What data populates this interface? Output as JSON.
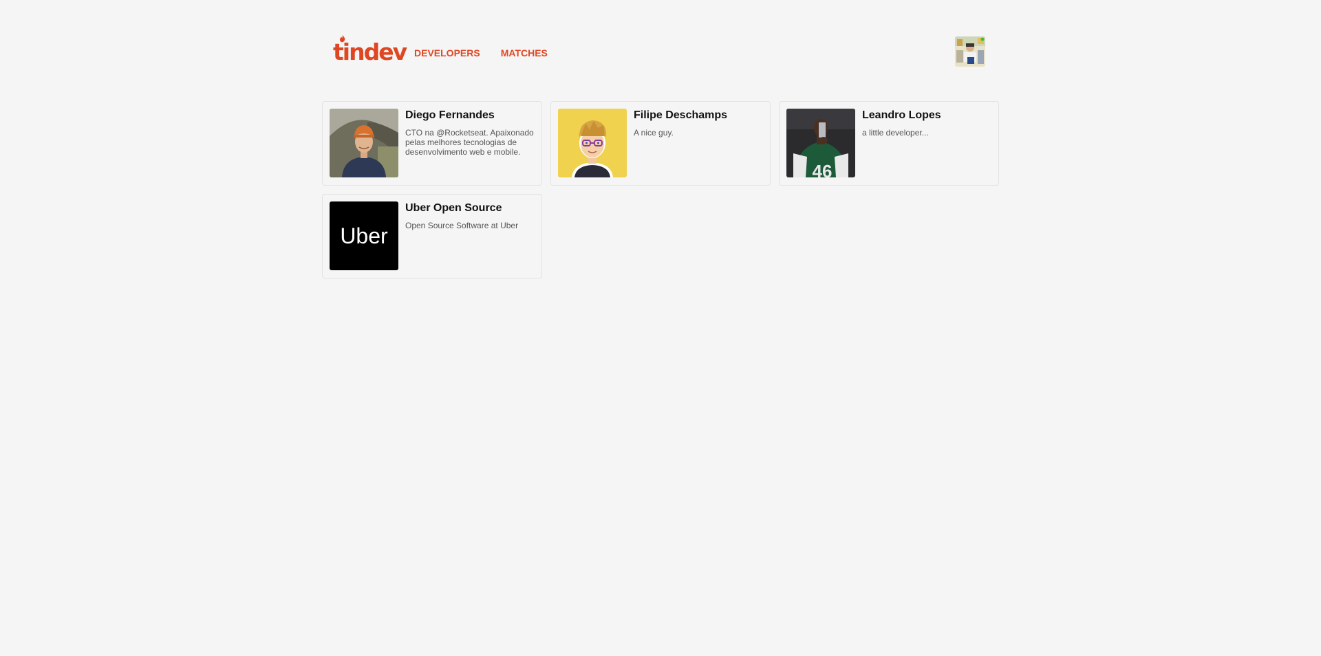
{
  "header": {
    "logo_text": "tindev",
    "brand_color": "#df4723",
    "nav": [
      {
        "label": "DEVELOPERS"
      },
      {
        "label": "MATCHES"
      }
    ]
  },
  "developers": [
    {
      "name": "Diego Fernandes",
      "bio": "CTO na @Rocketseat. Apaixonado pelas melhores tecnologias de desenvolvimento web e mobile."
    },
    {
      "name": "Filipe Deschamps",
      "bio": "A nice guy."
    },
    {
      "name": "Leandro Lopes",
      "bio": "a little developer..."
    },
    {
      "name": "Uber Open Source",
      "bio": "Open Source Software at Uber",
      "photo_text": "Uber"
    }
  ]
}
